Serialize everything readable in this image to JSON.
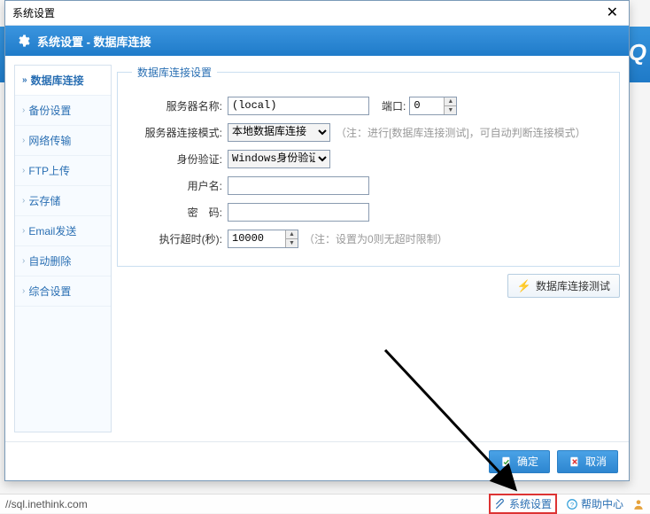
{
  "dialog": {
    "window_title": "系统设置",
    "header": "系统设置 - 数据库连接",
    "sidebar": [
      {
        "label": "数据库连接",
        "active": true
      },
      {
        "label": "备份设置"
      },
      {
        "label": "网络传输"
      },
      {
        "label": "FTP上传"
      },
      {
        "label": "云存储"
      },
      {
        "label": "Email发送"
      },
      {
        "label": "自动删除"
      },
      {
        "label": "综合设置"
      }
    ],
    "group_title": "数据库连接设置",
    "form": {
      "server_label": "服务器名称:",
      "server_value": "(local)",
      "port_label": "端口:",
      "port_value": "0",
      "mode_label": "服务器连接模式:",
      "mode_value": "本地数据库连接",
      "mode_note": "（注：进行[数据库连接测试]，可自动判断连接模式）",
      "auth_label": "身份验证:",
      "auth_value": "Windows身份验证",
      "user_label": "用户名:",
      "user_value": "",
      "pass_label": "密　码:",
      "pass_value": "",
      "timeout_label": "执行超时(秒):",
      "timeout_value": "10000",
      "timeout_note": "（注：设置为0则无超时限制）"
    },
    "buttons": {
      "test": "数据库连接测试",
      "ok": "确定",
      "cancel": "取消"
    }
  },
  "statusbar": {
    "url": "//sql.inethink.com",
    "system_settings": "系统设置",
    "help": "帮助中心"
  },
  "bg": {
    "sq": "SQ"
  }
}
